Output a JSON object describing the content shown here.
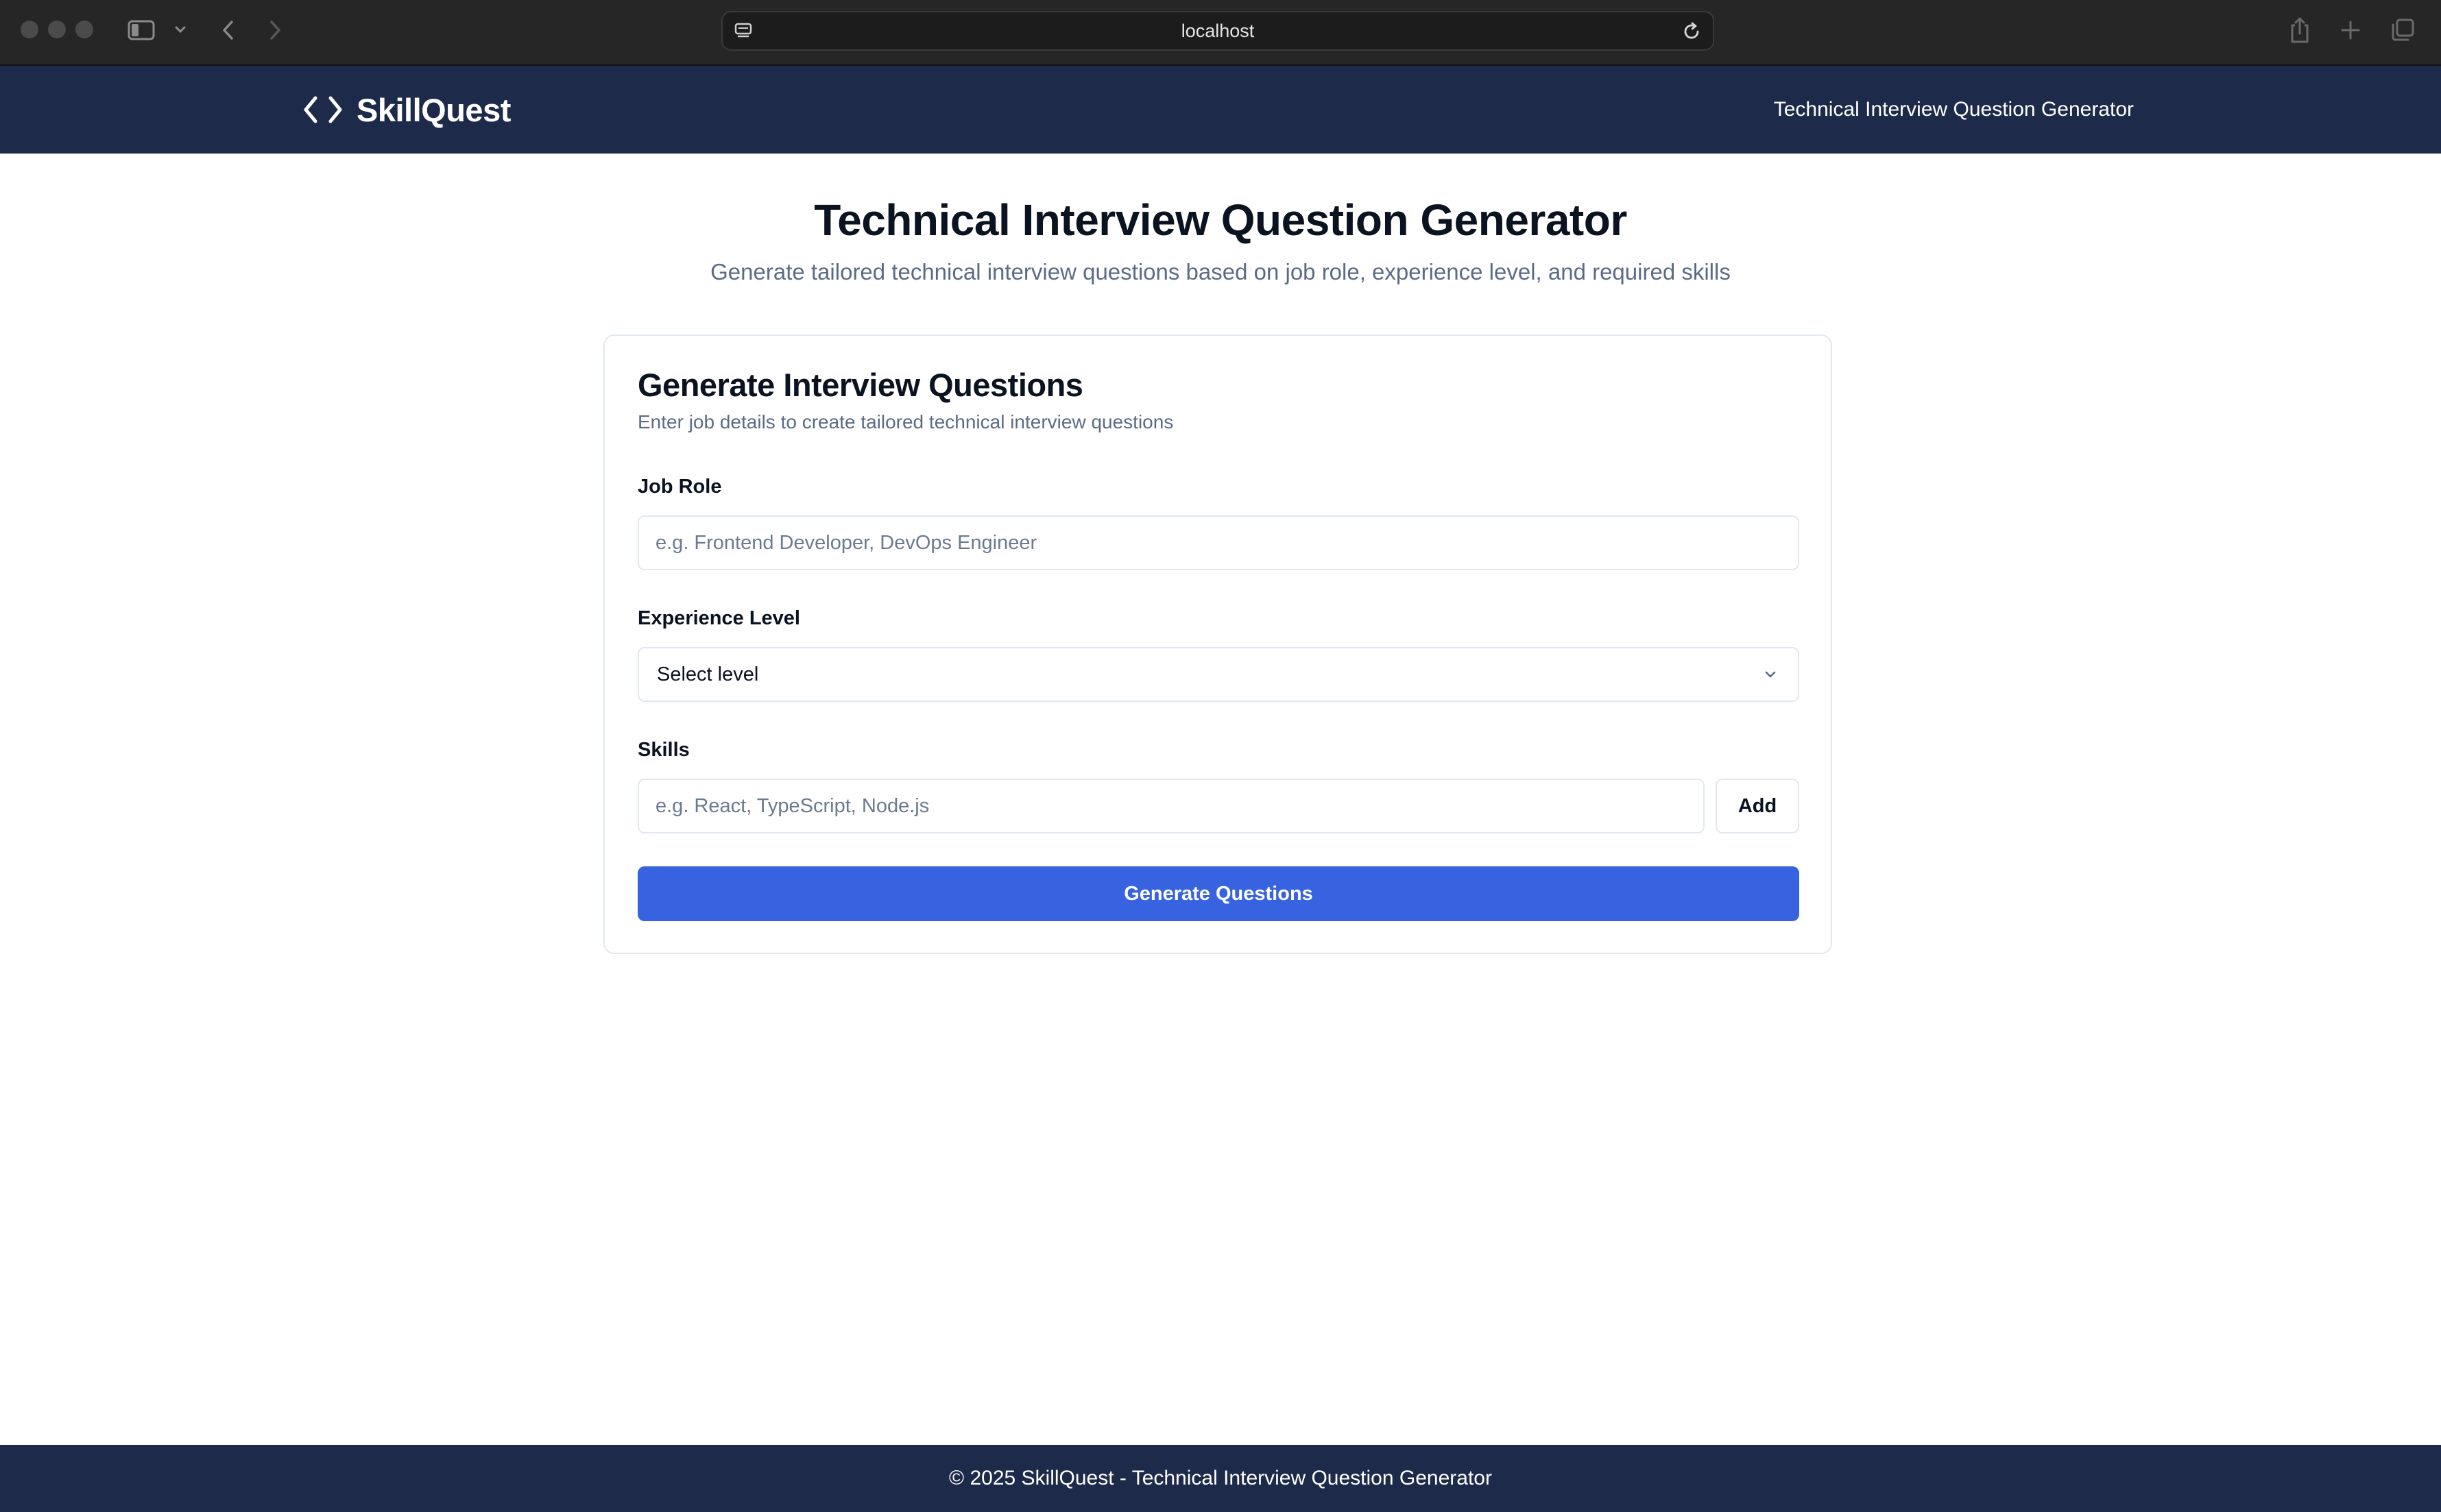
{
  "browser": {
    "url": "localhost",
    "icons": [
      "window-close",
      "window-minimize",
      "window-zoom",
      "sidebar-icon",
      "chevron-down-icon",
      "back-arrow-icon",
      "forward-arrow-icon",
      "site-settings-icon",
      "reload-icon",
      "share-icon",
      "new-tab-icon",
      "tabs-overview-icon"
    ]
  },
  "header": {
    "brand_icon": "code-brackets-icon",
    "brand_name": "SkillQuest",
    "nav_link": "Technical Interview Question Generator"
  },
  "main": {
    "title": "Technical Interview Question Generator",
    "subtitle": "Generate tailored technical interview questions based on job role, experience level, and required skills"
  },
  "form": {
    "title": "Generate Interview Questions",
    "description": "Enter job details to create tailored technical interview questions",
    "job_role": {
      "label": "Job Role",
      "placeholder": "e.g. Frontend Developer, DevOps Engineer",
      "value": ""
    },
    "experience": {
      "label": "Experience Level",
      "selected": "Select level"
    },
    "skills": {
      "label": "Skills",
      "placeholder": "e.g. React, TypeScript, Node.js",
      "value": "",
      "add_label": "Add"
    },
    "submit_label": "Generate Questions"
  },
  "footer": {
    "text": "© 2025 SkillQuest - Technical Interview Question Generator"
  },
  "colors": {
    "header_bg": "#1e2a4a",
    "primary_button": "#3863e0",
    "muted_text": "#5b6b86",
    "border": "#e2e8f0"
  }
}
